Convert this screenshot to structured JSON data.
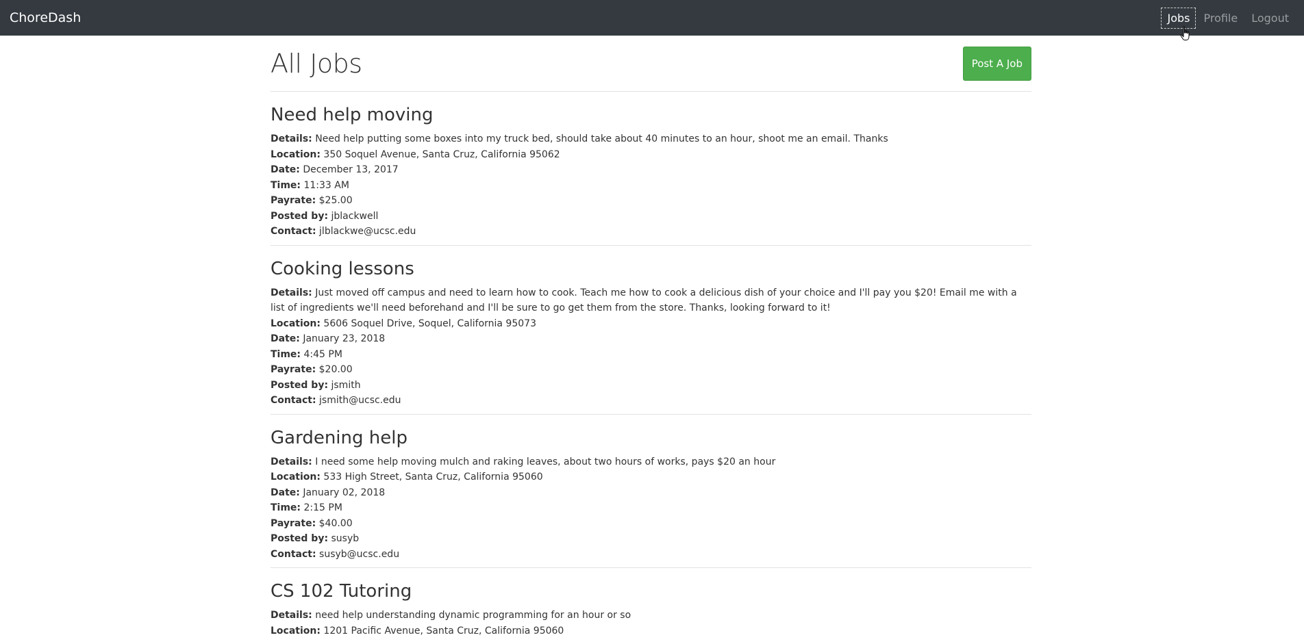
{
  "navbar": {
    "brand": "ChoreDash",
    "links": [
      {
        "label": "Jobs",
        "active": true
      },
      {
        "label": "Profile",
        "active": false
      },
      {
        "label": "Logout",
        "active": false
      }
    ]
  },
  "page": {
    "title": "All Jobs",
    "post_button": "Post A Job"
  },
  "labels": {
    "details": "Details:",
    "location": "Location:",
    "date": "Date:",
    "time": "Time:",
    "payrate": "Payrate:",
    "posted_by": "Posted by:",
    "contact": "Contact:"
  },
  "jobs": [
    {
      "title": "Need help moving",
      "details": "Need help putting some boxes into my truck bed, should take about 40 minutes to an hour, shoot me an email. Thanks",
      "location": "350 Soquel Avenue, Santa Cruz, California 95062",
      "date": "December 13, 2017",
      "time": "11:33 AM",
      "payrate": "$25.00",
      "posted_by": "jblackwell",
      "contact": "jlblackwe@ucsc.edu"
    },
    {
      "title": "Cooking lessons",
      "details": "Just moved off campus and need to learn how to cook. Teach me how to cook a delicious dish of your choice and I'll pay you $20! Email me with a list of ingredients we'll need beforehand and I'll be sure to go get them from the store. Thanks, looking forward to it!",
      "location": "5606 Soquel Drive, Soquel, California 95073",
      "date": "January 23, 2018",
      "time": "4:45 PM",
      "payrate": "$20.00",
      "posted_by": "jsmith",
      "contact": "jsmith@ucsc.edu"
    },
    {
      "title": "Gardening help",
      "details": "I need some help moving mulch and raking leaves, about two hours of works, pays $20 an hour",
      "location": "533 High Street, Santa Cruz, California 95060",
      "date": "January 02, 2018",
      "time": "2:15 PM",
      "payrate": "$40.00",
      "posted_by": "susyb",
      "contact": "susyb@ucsc.edu"
    },
    {
      "title": "CS 102 Tutoring",
      "details": "need help understanding dynamic programming for an hour or so",
      "location": "1201 Pacific Avenue, Santa Cruz, California 95060"
    }
  ],
  "colors": {
    "navbar_bg": "#343a40",
    "button_green": "#4cae4c"
  },
  "icons": {
    "cursor": "hand-pointer-icon"
  }
}
